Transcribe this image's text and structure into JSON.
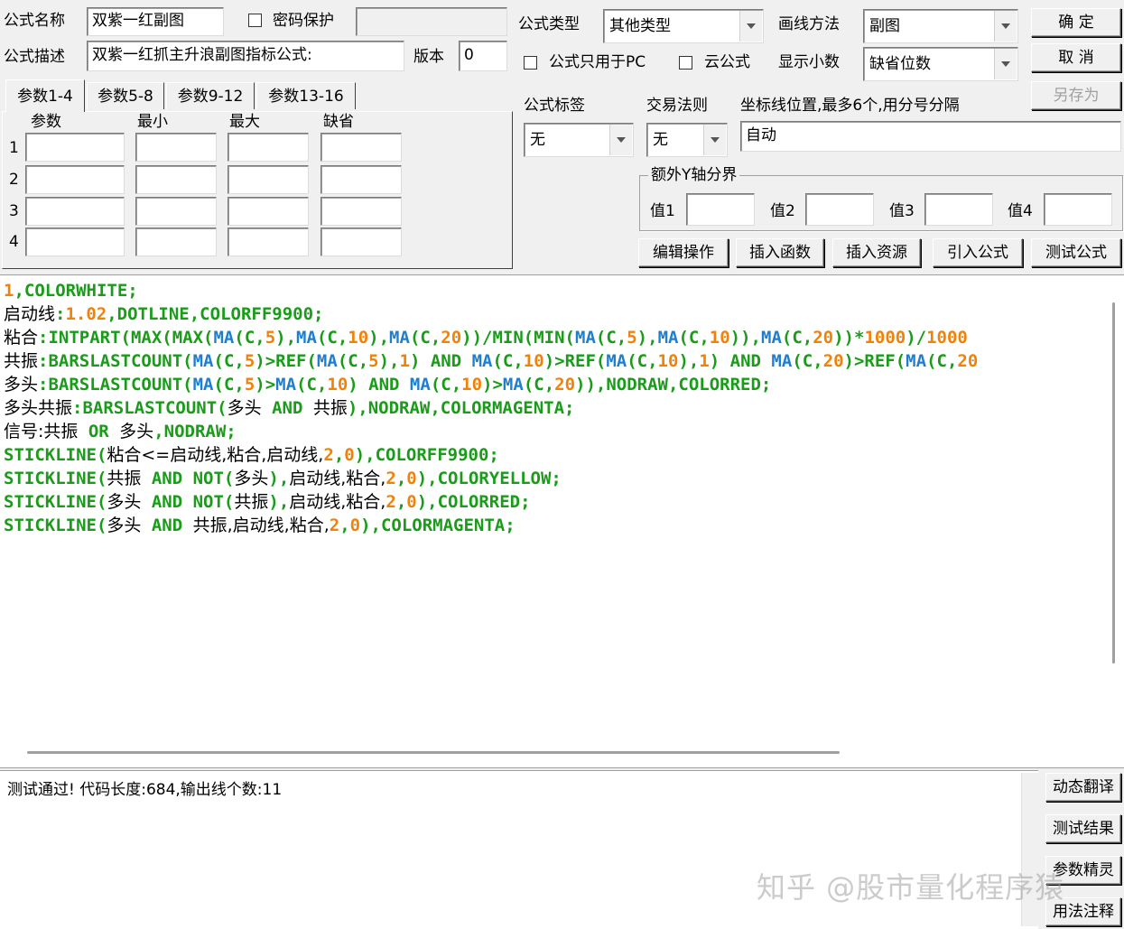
{
  "header": {
    "name_label": "公式名称",
    "name_value": "双紫一红副图",
    "password_label": "密码保护",
    "password_value": "",
    "desc_label": "公式描述",
    "desc_value": "双紫一红抓主升浪副图指标公式:",
    "version_label": "版本",
    "version_value": "0",
    "type_label": "公式类型",
    "type_value": "其他类型",
    "draw_label": "画线方法",
    "draw_value": "副图",
    "pc_only_label": "公式只用于PC",
    "cloud_label": "云公式",
    "decimals_label": "显示小数",
    "decimals_value": "缺省位数"
  },
  "buttons": {
    "ok": "确  定",
    "cancel": "取  消",
    "save_as": "另存为",
    "edit_ops": "编辑操作",
    "insert_func": "插入函数",
    "insert_res": "插入资源",
    "import_formula": "引入公式",
    "test_formula": "测试公式",
    "dyn_translate": "动态翻译",
    "test_result": "测试结果",
    "param_wizard": "参数精灵",
    "usage_notes": "用法注释"
  },
  "tabs": [
    "参数1-4",
    "参数5-8",
    "参数9-12",
    "参数13-16"
  ],
  "params": {
    "headers": [
      "参数",
      "最小",
      "最大",
      "缺省"
    ],
    "rows": [
      "1",
      "2",
      "3",
      "4"
    ]
  },
  "tags": {
    "label": "公式标签",
    "value": "无",
    "rule_label": "交易法则",
    "rule_value": "无",
    "coord_label": "坐标线位置,最多6个,用分号分隔",
    "coord_value": "自动",
    "yaxis_label": "额外Y轴分界",
    "v1": "值1",
    "v2": "值2",
    "v3": "值3",
    "v4": "值4"
  },
  "code_lines": [
    [
      [
        "o",
        "1"
      ],
      [
        "g",
        ",COLORWHITE;"
      ]
    ],
    [
      [
        "k",
        "启动线"
      ],
      [
        "g",
        ":"
      ],
      [
        "o",
        "1.02"
      ],
      [
        "g",
        ",DOTLINE,COLORFF9900;"
      ]
    ],
    [
      [
        "k",
        "粘合"
      ],
      [
        "g",
        ":INTPART(MAX(MAX("
      ],
      [
        "b",
        "MA"
      ],
      [
        "g",
        "(C,"
      ],
      [
        "o",
        "5"
      ],
      [
        "g",
        "),"
      ],
      [
        "b",
        "MA"
      ],
      [
        "g",
        "(C,"
      ],
      [
        "o",
        "10"
      ],
      [
        "g",
        "),"
      ],
      [
        "b",
        "MA"
      ],
      [
        "g",
        "(C,"
      ],
      [
        "o",
        "20"
      ],
      [
        "g",
        "))/MIN(MIN("
      ],
      [
        "b",
        "MA"
      ],
      [
        "g",
        "(C,"
      ],
      [
        "o",
        "5"
      ],
      [
        "g",
        "),"
      ],
      [
        "b",
        "MA"
      ],
      [
        "g",
        "(C,"
      ],
      [
        "o",
        "10"
      ],
      [
        "g",
        ")),"
      ],
      [
        "b",
        "MA"
      ],
      [
        "g",
        "(C,"
      ],
      [
        "o",
        "20"
      ],
      [
        "g",
        "))*"
      ],
      [
        "o",
        "1000"
      ],
      [
        "g",
        ")/"
      ],
      [
        "o",
        "1000"
      ]
    ],
    [
      [
        "k",
        "共振"
      ],
      [
        "g",
        ":BARSLASTCOUNT("
      ],
      [
        "b",
        "MA"
      ],
      [
        "g",
        "(C,"
      ],
      [
        "o",
        "5"
      ],
      [
        "g",
        ")>REF("
      ],
      [
        "b",
        "MA"
      ],
      [
        "g",
        "(C,"
      ],
      [
        "o",
        "5"
      ],
      [
        "g",
        "),"
      ],
      [
        "o",
        "1"
      ],
      [
        "g",
        ") AND "
      ],
      [
        "b",
        "MA"
      ],
      [
        "g",
        "(C,"
      ],
      [
        "o",
        "10"
      ],
      [
        "g",
        ")>REF("
      ],
      [
        "b",
        "MA"
      ],
      [
        "g",
        "(C,"
      ],
      [
        "o",
        "10"
      ],
      [
        "g",
        "),"
      ],
      [
        "o",
        "1"
      ],
      [
        "g",
        ") AND "
      ],
      [
        "b",
        "MA"
      ],
      [
        "g",
        "(C,"
      ],
      [
        "o",
        "20"
      ],
      [
        "g",
        ")>REF("
      ],
      [
        "b",
        "MA"
      ],
      [
        "g",
        "(C,"
      ],
      [
        "o",
        "20"
      ]
    ],
    [
      [
        "k",
        "多头"
      ],
      [
        "g",
        ":BARSLASTCOUNT("
      ],
      [
        "b",
        "MA"
      ],
      [
        "g",
        "(C,"
      ],
      [
        "o",
        "5"
      ],
      [
        "g",
        ")>"
      ],
      [
        "b",
        "MA"
      ],
      [
        "g",
        "(C,"
      ],
      [
        "o",
        "10"
      ],
      [
        "g",
        ") AND "
      ],
      [
        "b",
        "MA"
      ],
      [
        "g",
        "(C,"
      ],
      [
        "o",
        "10"
      ],
      [
        "g",
        ")>"
      ],
      [
        "b",
        "MA"
      ],
      [
        "g",
        "(C,"
      ],
      [
        "o",
        "20"
      ],
      [
        "g",
        ")),NODRAW,COLORRED;"
      ]
    ],
    [
      [
        "k",
        "多头共振"
      ],
      [
        "g",
        ":BARSLASTCOUNT("
      ],
      [
        "k",
        "多头"
      ],
      [
        "g",
        " AND "
      ],
      [
        "k",
        "共振"
      ],
      [
        "g",
        "),NODRAW,COLORMAGENTA;"
      ]
    ],
    [
      [
        "k",
        "信号:共振"
      ],
      [
        "g",
        " OR "
      ],
      [
        "k",
        "多头"
      ],
      [
        "g",
        ",NODRAW;"
      ]
    ],
    [
      [
        "g",
        "STICKLINE("
      ],
      [
        "k",
        "粘合<=启动线,粘合,启动线,"
      ],
      [
        "o",
        "2"
      ],
      [
        "g",
        ","
      ],
      [
        "o",
        "0"
      ],
      [
        "g",
        "),COLORFF9900;"
      ]
    ],
    [
      [
        "g",
        "STICKLINE("
      ],
      [
        "k",
        "共振"
      ],
      [
        "g",
        " AND NOT("
      ],
      [
        "k",
        "多头"
      ],
      [
        "g",
        "),"
      ],
      [
        "k",
        "启动线,粘合,"
      ],
      [
        "o",
        "2"
      ],
      [
        "g",
        ","
      ],
      [
        "o",
        "0"
      ],
      [
        "g",
        "),COLORYELLOW;"
      ]
    ],
    [
      [
        "g",
        "STICKLINE("
      ],
      [
        "k",
        "多头"
      ],
      [
        "g",
        " AND NOT("
      ],
      [
        "k",
        "共振"
      ],
      [
        "g",
        "),"
      ],
      [
        "k",
        "启动线,粘合,"
      ],
      [
        "o",
        "2"
      ],
      [
        "g",
        ","
      ],
      [
        "o",
        "0"
      ],
      [
        "g",
        "),COLORRED;"
      ]
    ],
    [
      [
        "g",
        "STICKLINE("
      ],
      [
        "k",
        "多头"
      ],
      [
        "g",
        " AND "
      ],
      [
        "k",
        "共振,启动线,粘合,"
      ],
      [
        "o",
        "2"
      ],
      [
        "g",
        ","
      ],
      [
        "o",
        "0"
      ],
      [
        "g",
        "),COLORMAGENTA;"
      ]
    ]
  ],
  "result_text": "测试通过! 代码长度:684,输出线个数:11",
  "watermark": "知乎 @股市量化程序猿"
}
